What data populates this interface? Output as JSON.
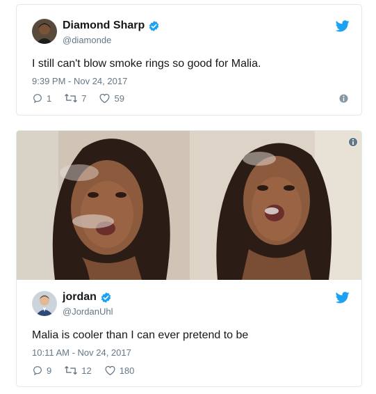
{
  "tweets": [
    {
      "name": "Diamond Sharp",
      "handle": "@diamonde",
      "verified": true,
      "text": "I still can't blow smoke rings so good for Malia.",
      "timestamp": "9:39 PM - Nov 24, 2017",
      "replies": "1",
      "retweets": "7",
      "likes": "59"
    },
    {
      "name": "jordan",
      "handle": "@JordanUhl",
      "verified": true,
      "text": "Malia is cooler than I can ever pretend to be",
      "timestamp": "10:11 AM - Nov 24, 2017",
      "replies": "9",
      "retweets": "12",
      "likes": "180"
    }
  ],
  "colors": {
    "twitter_blue": "#1da1f2",
    "text": "#14171a",
    "muted": "#657786",
    "border": "#e1e8ed"
  },
  "icons": [
    "twitter-bird-icon",
    "verified-badge-icon",
    "reply-icon",
    "retweet-icon",
    "like-icon",
    "info-icon"
  ]
}
